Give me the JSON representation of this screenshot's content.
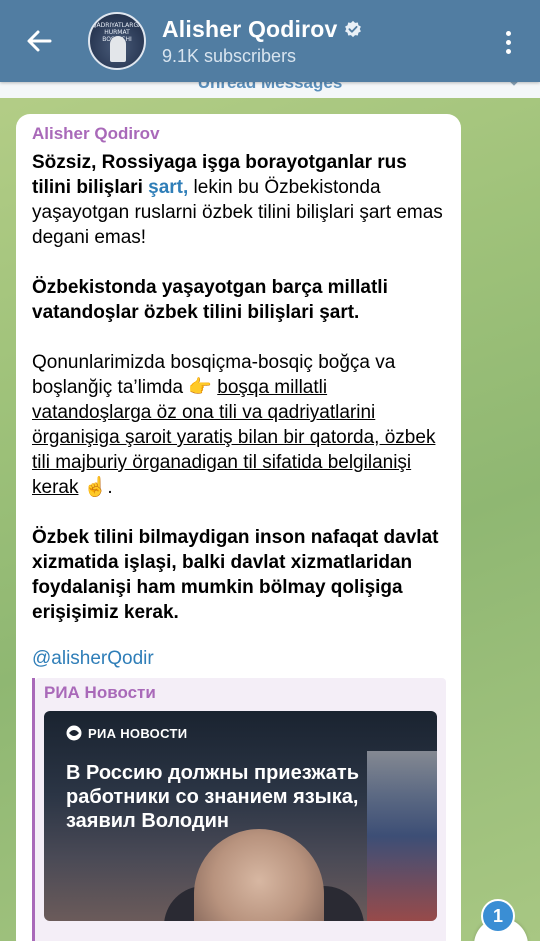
{
  "header": {
    "channel_name": "Alisher Qodirov",
    "subscribers": "9.1K subscribers",
    "avatar_text": "QADRIYATLARGA HURMAT BOSQICHI",
    "accent_color": "#517da2"
  },
  "unread_bar": {
    "label": "Unread Messages"
  },
  "message": {
    "sender": "Alisher Qodirov",
    "p1_part1": "Sözsiz, Rossiyaga işga borayotganlar rus tilini bilişlari ",
    "p1_link": "şart,",
    "p1_part2": " lekin bu Özbekistonda yaşayotgan ruslarni özbek tilini bilişlari şart emas degani emas!",
    "p2": "Özbekistonda yaşayotgan barça millatli vatandoşlar özbek tilini bilişlari şart.",
    "p3_part1": "Qonunlarimizda bosqiçma-bosqiç boğça va boşlanğiç ta’limda ",
    "p3_emoji1": "👉",
    "p3_underlined": "boşqa millatli vatandoşlarga öz ona tili va qadriyatlarini örganişiga şaroit yaratiş bilan bir qatorda, özbek tili majburiy örganadigan til sifatida belgilanişi kerak",
    "p3_emoji2": "☝️",
    "p3_end": ".",
    "p4": "Özbek tilini bilmaydigan inson nafaqat davlat xizmatida işlaşi, balki davlat xizmatlaridan foydalanişi ham mumkin bölmay qolişiga erişişimiz kerak.",
    "handle": "@alisherQodir"
  },
  "preview": {
    "source": "РИА Новости",
    "logo_text": "РИА НОВОСТИ",
    "headline": "В Россию должны приезжать работники со знанием языка, заявил Володин"
  },
  "scroll_badge": {
    "count": "1"
  }
}
